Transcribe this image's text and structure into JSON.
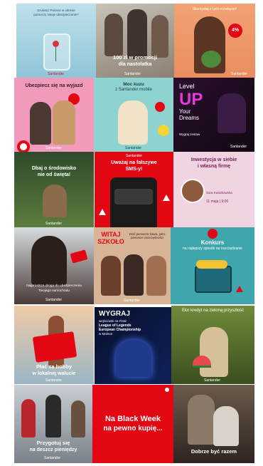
{
  "tiles": {
    "t1": {
      "headline": "Santander",
      "body_lines": [
        "Szukasz Paneze w okresie",
        "pomoczy swoje ubezpieczenie?"
      ],
      "logo": "Santander"
    },
    "t2": {
      "headline": "100 zł w promocji",
      "sub": "dla nastolatka",
      "logo": "Santander"
    },
    "t3": {
      "headline": "Skorzystaj z tych rozwiązań!",
      "badge": "4%",
      "logo": "Santander"
    },
    "t4": {
      "headline": "Ubezpiecz się na wyjazd",
      "logo": "Santander"
    },
    "t5": {
      "headline": "Moc kuzu",
      "sub": "z Santander mobile",
      "logo": "Santander"
    },
    "t6": {
      "line1": "Level",
      "line2": "UP",
      "line3": "Your",
      "line4": "Dreams",
      "caption": "Wygraj zestaw",
      "logo": "Santander"
    },
    "t7": {
      "headline": "Dbaj o środowisko",
      "sub": "nie od święta!",
      "logo": "Santander"
    },
    "t8": {
      "brand": "Santander",
      "headline": "Uważaj na fałszywe",
      "sub": "SMS-y!"
    },
    "t9": {
      "headline": "Inwestycja w siebie",
      "sub": "i własną firmę",
      "name": "Sara Kwiatkowska",
      "date": "11 maja | 9:00"
    },
    "t10": {
      "caption": "Najprostsza droga do ubezpieczenia",
      "caption2": "Twojego samochodu",
      "logo": "Santander"
    },
    "t11": {
      "headline": "WITAJ",
      "headline2": "SZKOŁO",
      "side": "Dziś pierwsza kawa, jutro pierwsze oszczędności",
      "logo": "Santander"
    },
    "t12": {
      "headline": "Konkurs",
      "sub": "na najlepszy sposób na oszczędzanie",
      "logo": "Santander"
    },
    "t13": {
      "headline": "Płać za hobby",
      "sub": "w lokalnej walucie",
      "logo": "Santander"
    },
    "t14": {
      "headline": "WYGRAJ",
      "sub1": "wejściówki na Finał",
      "sub2": "League of Legends",
      "sub3": "European Championship",
      "sub4": "w Malmo!"
    },
    "t15": {
      "headline": "Eko kredyt na zieloną przyszłość",
      "logo": "Santander"
    },
    "t16": {
      "headline": "Przygotuj się",
      "sub": "na deszcz pieniędzy",
      "logo": "Santander"
    },
    "t17": {
      "headline": "Na Black Week",
      "sub": "na pewno kupię...",
      "logo": "Santander"
    },
    "t18": {
      "headline": "Dobrze być razem",
      "logo": "Santander"
    }
  },
  "colors": {
    "brand_red": "#e30613"
  }
}
